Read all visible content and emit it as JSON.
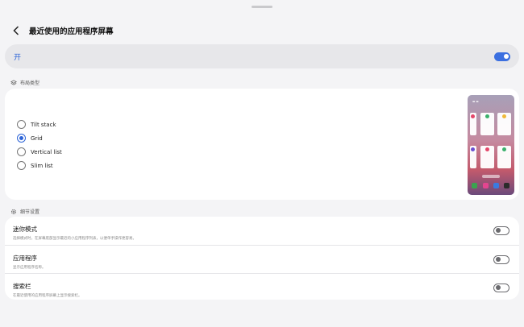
{
  "header": {
    "title": "最近使用的应用程序屏幕"
  },
  "master_switch": {
    "label": "开",
    "state": "on"
  },
  "layout_section": {
    "title": "布局类型",
    "options": [
      {
        "label": "Tilt stack",
        "checked": false
      },
      {
        "label": "Grid",
        "checked": true
      },
      {
        "label": "Vertical list",
        "checked": false
      },
      {
        "label": "Slim list",
        "checked": false
      }
    ]
  },
  "detail_section": {
    "title": "细节设置",
    "items": [
      {
        "title": "迷你模式",
        "subtitle": "选择模式时，在屏幕底部显示最近的小应用程序列表，以便单手操作更容易。",
        "state": "off"
      },
      {
        "title": "应用程序",
        "subtitle": "显示应用程序名称。",
        "state": "off"
      },
      {
        "title": "搜索栏",
        "subtitle": "在最近使用的应用程序屏幕上显示搜索栏。",
        "state": "off"
      }
    ]
  },
  "colors": {
    "accent": "#3b6fe0",
    "text_accent": "#2d64d7",
    "background": "#f4f4f6",
    "card": "#ffffff"
  }
}
